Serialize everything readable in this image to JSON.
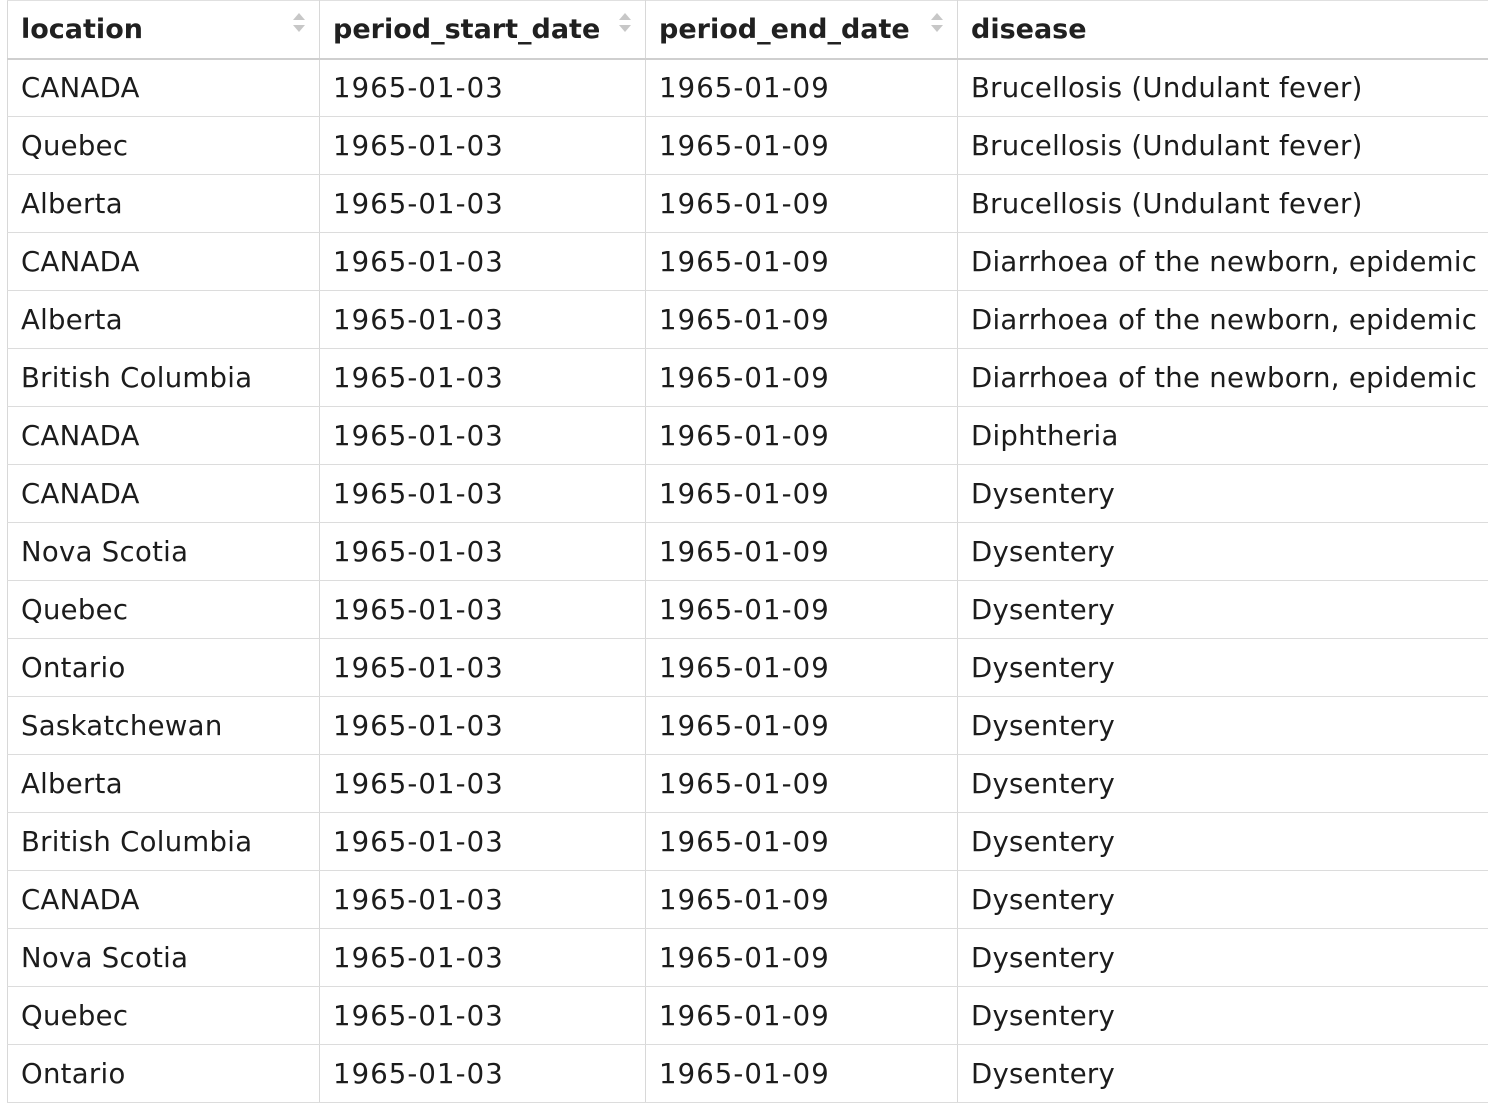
{
  "columns": [
    {
      "label": "location"
    },
    {
      "label": "period_start_date"
    },
    {
      "label": "period_end_date"
    },
    {
      "label": "disease"
    }
  ],
  "rows": [
    {
      "location": "CANADA",
      "start": "1965-01-03",
      "end": "1965-01-09",
      "disease": "Brucellosis (Undulant fever)"
    },
    {
      "location": "Quebec",
      "start": "1965-01-03",
      "end": "1965-01-09",
      "disease": "Brucellosis (Undulant fever)"
    },
    {
      "location": "Alberta",
      "start": "1965-01-03",
      "end": "1965-01-09",
      "disease": "Brucellosis (Undulant fever)"
    },
    {
      "location": "CANADA",
      "start": "1965-01-03",
      "end": "1965-01-09",
      "disease": "Diarrhoea of the newborn, epidemic"
    },
    {
      "location": "Alberta",
      "start": "1965-01-03",
      "end": "1965-01-09",
      "disease": "Diarrhoea of the newborn, epidemic"
    },
    {
      "location": "British Columbia",
      "start": "1965-01-03",
      "end": "1965-01-09",
      "disease": "Diarrhoea of the newborn, epidemic"
    },
    {
      "location": "CANADA",
      "start": "1965-01-03",
      "end": "1965-01-09",
      "disease": "Diphtheria"
    },
    {
      "location": "CANADA",
      "start": "1965-01-03",
      "end": "1965-01-09",
      "disease": "Dysentery"
    },
    {
      "location": "Nova Scotia",
      "start": "1965-01-03",
      "end": "1965-01-09",
      "disease": "Dysentery"
    },
    {
      "location": "Quebec",
      "start": "1965-01-03",
      "end": "1965-01-09",
      "disease": "Dysentery"
    },
    {
      "location": "Ontario",
      "start": "1965-01-03",
      "end": "1965-01-09",
      "disease": "Dysentery"
    },
    {
      "location": "Saskatchewan",
      "start": "1965-01-03",
      "end": "1965-01-09",
      "disease": "Dysentery"
    },
    {
      "location": "Alberta",
      "start": "1965-01-03",
      "end": "1965-01-09",
      "disease": "Dysentery"
    },
    {
      "location": "British Columbia",
      "start": "1965-01-03",
      "end": "1965-01-09",
      "disease": "Dysentery"
    },
    {
      "location": "CANADA",
      "start": "1965-01-03",
      "end": "1965-01-09",
      "disease": "Dysentery"
    },
    {
      "location": "Nova Scotia",
      "start": "1965-01-03",
      "end": "1965-01-09",
      "disease": "Dysentery"
    },
    {
      "location": "Quebec",
      "start": "1965-01-03",
      "end": "1965-01-09",
      "disease": "Dysentery"
    },
    {
      "location": "Ontario",
      "start": "1965-01-03",
      "end": "1965-01-09",
      "disease": "Dysentery"
    }
  ],
  "colors": {
    "border": "#d8d8d8",
    "text": "#1c1c1c",
    "sort_icon": "#c7c7c7"
  },
  "icons": {
    "sort": "sort-arrows-icon"
  }
}
